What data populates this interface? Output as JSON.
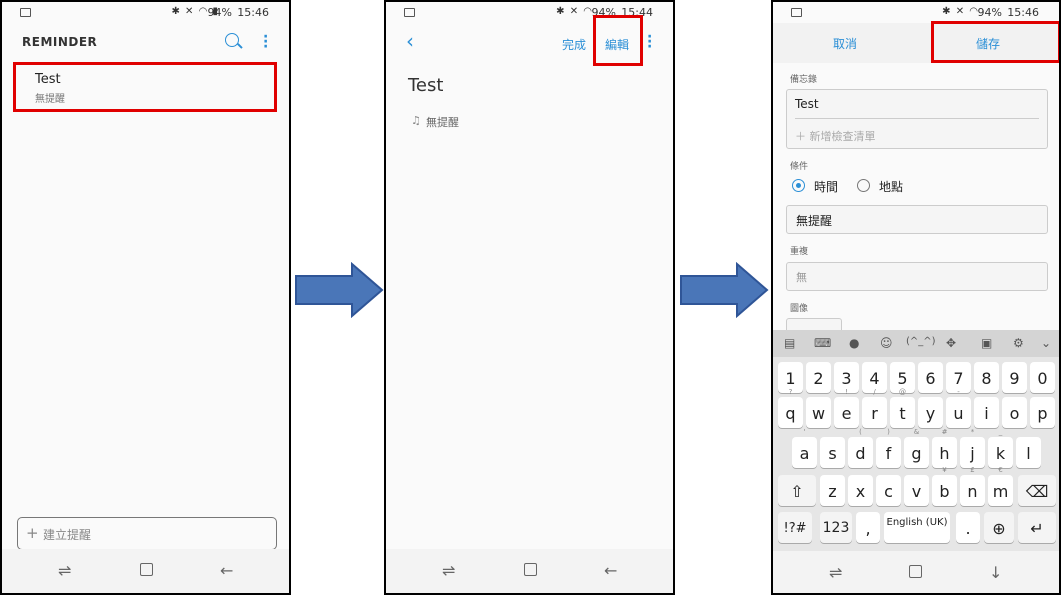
{
  "status": {
    "battery": "94%",
    "time1": "15:46",
    "time2": "15:44",
    "time3": "15:46"
  },
  "screen1": {
    "app_title": "REMINDER",
    "item_title": "Test",
    "item_sub": "無提醒",
    "add_placeholder": "建立提醒"
  },
  "screen2": {
    "done": "完成",
    "edit": "編輯",
    "note_title": "Test",
    "no_reminder": "無提醒"
  },
  "screen3": {
    "cancel": "取消",
    "save": "儲存",
    "memo_label": "備忘錄",
    "memo_value": "Test",
    "add_checklist": "新增檢查清單",
    "condition_label": "條件",
    "opt_time": "時間",
    "opt_place": "地點",
    "reminder_value": "無提醒",
    "repeat_label": "重複",
    "repeat_value": "無",
    "image_label": "圖像",
    "keyboard": {
      "toolbar": [
        "(^_^)"
      ],
      "num_row": [
        "1",
        "2",
        "3",
        "4",
        "5",
        "6",
        "7",
        "8",
        "9",
        "0"
      ],
      "row1": [
        "q",
        "w",
        "e",
        "r",
        "t",
        "y",
        "u",
        "i",
        "o",
        "p"
      ],
      "row1_hints": [
        "?",
        "",
        "!",
        "/",
        "@",
        "",
        "-",
        "",
        "",
        ""
      ],
      "row2": [
        "a",
        "s",
        "d",
        "f",
        "g",
        "h",
        "j",
        "k",
        "l"
      ],
      "row2_hints": [
        "'",
        "",
        "(",
        ")",
        "&",
        "#",
        "*",
        "_",
        ""
      ],
      "row3": [
        "z",
        "x",
        "c",
        "v",
        "b",
        "n",
        "m"
      ],
      "row3_hints": [
        "",
        "",
        "",
        "",
        "¥",
        "£",
        "€"
      ],
      "sym": "!?#",
      "num": "123",
      "comma": ",",
      "space": "English (UK)",
      "period": "."
    }
  }
}
